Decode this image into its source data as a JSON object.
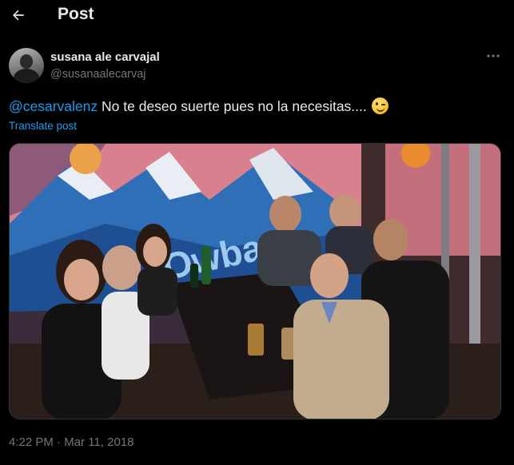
{
  "header": {
    "title": "Post",
    "back_icon": "arrow-left-icon"
  },
  "author": {
    "display_name": "susana ale carvajal",
    "handle": "@susanaalecarvaj"
  },
  "post": {
    "mention": "@cesarvalenz",
    "text": " No te deseo suerte pues no la necesitas....",
    "emoji": "winking-face",
    "translate_label": "Translate post",
    "timestamp": "4:22 PM · Mar 11, 2018"
  },
  "media": {
    "mural_text": "Owbar"
  },
  "colors": {
    "background": "#000000",
    "primary_text": "#e7e9ea",
    "secondary_text": "#71767b",
    "link": "#1d9bf0"
  }
}
